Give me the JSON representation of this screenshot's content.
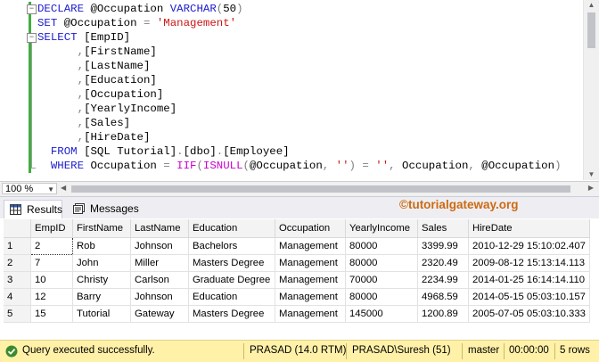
{
  "editor": {
    "lines": [
      [
        {
          "t": "DECLARE ",
          "c": "kw"
        },
        {
          "t": "@Occupation ",
          "c": "id"
        },
        {
          "t": "VARCHAR",
          "c": "kw"
        },
        {
          "t": "(",
          "c": "gray"
        },
        {
          "t": "50",
          "c": "id"
        },
        {
          "t": ")",
          "c": "gray"
        }
      ],
      [
        {
          "t": "SET ",
          "c": "kw"
        },
        {
          "t": "@Occupation ",
          "c": "id"
        },
        {
          "t": "= ",
          "c": "gray"
        },
        {
          "t": "'Management'",
          "c": "str"
        }
      ],
      [
        {
          "t": "SELECT ",
          "c": "kw"
        },
        {
          "t": "[EmpID]",
          "c": "id"
        }
      ],
      [
        {
          "t": "      ,",
          "c": "gray"
        },
        {
          "t": "[FirstName]",
          "c": "id"
        }
      ],
      [
        {
          "t": "      ,",
          "c": "gray"
        },
        {
          "t": "[LastName]",
          "c": "id"
        }
      ],
      [
        {
          "t": "      ,",
          "c": "gray"
        },
        {
          "t": "[Education]",
          "c": "id"
        }
      ],
      [
        {
          "t": "      ,",
          "c": "gray"
        },
        {
          "t": "[Occupation]",
          "c": "id"
        }
      ],
      [
        {
          "t": "      ,",
          "c": "gray"
        },
        {
          "t": "[YearlyIncome]",
          "c": "id"
        }
      ],
      [
        {
          "t": "      ,",
          "c": "gray"
        },
        {
          "t": "[Sales]",
          "c": "id"
        }
      ],
      [
        {
          "t": "      ,",
          "c": "gray"
        },
        {
          "t": "[HireDate]",
          "c": "id"
        }
      ],
      [
        {
          "t": "  FROM ",
          "c": "kw"
        },
        {
          "t": "[SQL Tutorial]",
          "c": "id"
        },
        {
          "t": ".",
          "c": "gray"
        },
        {
          "t": "[dbo]",
          "c": "id"
        },
        {
          "t": ".",
          "c": "gray"
        },
        {
          "t": "[Employee]",
          "c": "id"
        }
      ],
      [
        {
          "t": "  WHERE ",
          "c": "kw"
        },
        {
          "t": "Occupation ",
          "c": "id"
        },
        {
          "t": "= ",
          "c": "gray"
        },
        {
          "t": "IIF",
          "c": "fn"
        },
        {
          "t": "(",
          "c": "gray"
        },
        {
          "t": "ISNULL",
          "c": "fn"
        },
        {
          "t": "(",
          "c": "gray"
        },
        {
          "t": "@Occupation",
          "c": "id"
        },
        {
          "t": ", ",
          "c": "gray"
        },
        {
          "t": "''",
          "c": "str"
        },
        {
          "t": ") = ",
          "c": "gray"
        },
        {
          "t": "''",
          "c": "str"
        },
        {
          "t": ", ",
          "c": "gray"
        },
        {
          "t": "Occupation",
          "c": "id"
        },
        {
          "t": ", ",
          "c": "gray"
        },
        {
          "t": "@Occupation",
          "c": "id"
        },
        {
          "t": ")",
          "c": "gray"
        }
      ]
    ]
  },
  "zoom": "100 %",
  "tabs": {
    "results": "Results",
    "messages": "Messages"
  },
  "watermark": "©tutorialgateway.org",
  "grid": {
    "columns": [
      "EmpID",
      "FirstName",
      "LastName",
      "Education",
      "Occupation",
      "YearlyIncome",
      "Sales",
      "HireDate"
    ],
    "rows": [
      [
        "1",
        "2",
        "Rob",
        "Johnson",
        "Bachelors",
        "Management",
        "80000",
        "3399.99",
        "2010-12-29 15:10:02.407"
      ],
      [
        "2",
        "7",
        "John",
        "Miller",
        "Masters Degree",
        "Management",
        "80000",
        "2320.49",
        "2009-08-12 15:13:14.113"
      ],
      [
        "3",
        "10",
        "Christy",
        "Carlson",
        "Graduate Degree",
        "Management",
        "70000",
        "2234.99",
        "2014-01-25 16:14:14.110"
      ],
      [
        "4",
        "12",
        "Barry",
        "Johnson",
        "Education",
        "Management",
        "80000",
        "4968.59",
        "2014-05-15 05:03:10.157"
      ],
      [
        "5",
        "15",
        "Tutorial",
        "Gateway",
        "Masters Degree",
        "Management",
        "145000",
        "1200.89",
        "2005-07-05 05:03:10.333"
      ]
    ]
  },
  "status": {
    "message": "Query executed successfully.",
    "server": "PRASAD (14.0 RTM)",
    "user": "PRASAD\\Suresh (51)",
    "database": "master",
    "time": "00:00:00",
    "rows": "5 rows"
  },
  "colors": {
    "keyword": "#1c1ccc",
    "string": "#cc1515",
    "function": "#cc00cc",
    "status_bg": "#fff1a8",
    "watermark": "#cc6a12"
  }
}
